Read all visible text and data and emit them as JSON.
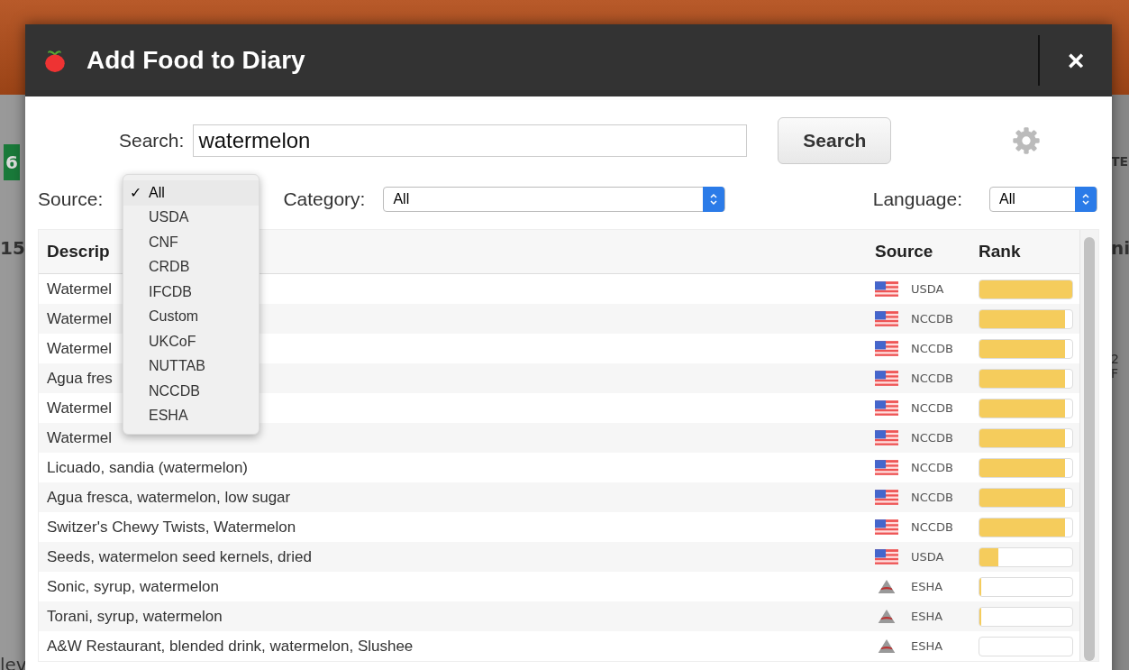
{
  "background": {
    "left_fragments": [
      "6",
      "15",
      "lev"
    ],
    "right_fragments": [
      "TE",
      "ni",
      "2 F"
    ]
  },
  "dialog": {
    "title": "Add Food to Diary",
    "close": "×"
  },
  "search": {
    "label": "Search:",
    "value": "watermelon",
    "button": "Search"
  },
  "filters": [
    {
      "label": "Source:",
      "kind": "menu"
    },
    {
      "label": "Category:",
      "kind": "select",
      "value": "All"
    },
    {
      "label": "Language:",
      "kind": "select",
      "value": "All"
    }
  ],
  "source_menu": {
    "check": "✓",
    "items": [
      {
        "label": "All",
        "selected": true
      },
      {
        "label": "USDA",
        "selected": false
      },
      {
        "label": "CNF",
        "selected": false
      },
      {
        "label": "CRDB",
        "selected": false
      },
      {
        "label": "IFCDB",
        "selected": false
      },
      {
        "label": "Custom",
        "selected": false
      },
      {
        "label": "UKCoF",
        "selected": false
      },
      {
        "label": "NUTTAB",
        "selected": false
      },
      {
        "label": "NCCDB",
        "selected": false
      },
      {
        "label": "ESHA",
        "selected": false
      }
    ]
  },
  "table": {
    "columns": [
      "Descrip",
      "Source",
      "Rank"
    ],
    "rows": [
      {
        "description": "Watermel",
        "source": "USDA",
        "kind": "flag",
        "level": 1.0
      },
      {
        "description": "Watermel",
        "source": "NCCDB",
        "kind": "flag",
        "level": 0.92
      },
      {
        "description": "Watermel",
        "source": "NCCDB",
        "kind": "flag",
        "level": 0.92
      },
      {
        "description": "Agua fres",
        "source": "NCCDB",
        "kind": "flag",
        "level": 0.92
      },
      {
        "description": "Watermel",
        "source": "NCCDB",
        "kind": "flag",
        "level": 0.92
      },
      {
        "description": "Watermel",
        "source": "NCCDB",
        "kind": "flag",
        "level": 0.92
      },
      {
        "description": "Licuado, sandia (watermelon)",
        "source": "NCCDB",
        "kind": "flag",
        "level": 0.92
      },
      {
        "description": "Agua fresca, watermelon, low sugar",
        "source": "NCCDB",
        "kind": "flag",
        "level": 0.92
      },
      {
        "description": "Switzer's Chewy Twists, Watermelon",
        "source": "NCCDB",
        "kind": "flag",
        "level": 0.92
      },
      {
        "description": "Seeds, watermelon seed kernels, dried",
        "source": "USDA",
        "kind": "flag",
        "level": 0.2
      },
      {
        "description": "Sonic, syrup, watermelon",
        "source": "ESHA",
        "kind": "logo",
        "level": 0.02
      },
      {
        "description": "Torani, syrup, watermelon",
        "source": "ESHA",
        "kind": "logo",
        "level": 0.02
      },
      {
        "description": "A&W Restaurant, blended drink, watermelon, Slushee",
        "source": "ESHA",
        "kind": "logo"
      }
    ]
  }
}
